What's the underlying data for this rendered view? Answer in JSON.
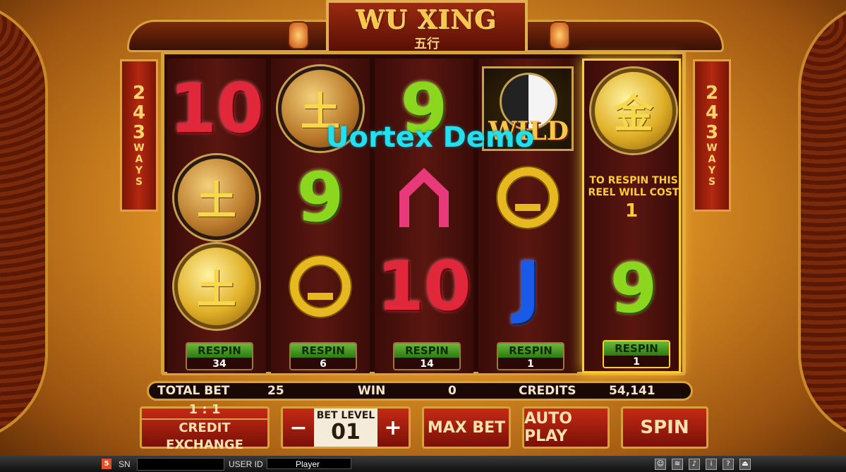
{
  "header": {
    "title": "WU XING",
    "subtitle": "五行"
  },
  "ways_banner": {
    "digits": [
      "2",
      "4",
      "3"
    ],
    "word_letters": [
      "W",
      "A",
      "Y",
      "S"
    ]
  },
  "watermark": "Uortex Demo",
  "reels": [
    {
      "symbols": [
        "10",
        "土",
        "土"
      ],
      "respin_label": "RESPIN",
      "respin_count": "34"
    },
    {
      "symbols": [
        "土",
        "9",
        "Q"
      ],
      "respin_label": "RESPIN",
      "respin_count": "6"
    },
    {
      "symbols": [
        "9",
        "A",
        "10"
      ],
      "respin_label": "RESPIN",
      "respin_count": "14"
    },
    {
      "symbols": [
        "WILD",
        "Q",
        "J"
      ],
      "respin_label": "RESPIN",
      "respin_count": "1"
    },
    {
      "symbols": [
        "金",
        "",
        "9"
      ],
      "respin_label": "RESPIN",
      "respin_count": "1",
      "respin_note": "TO RESPIN THIS REEL WILL COST",
      "respin_cost": "1",
      "active": true
    }
  ],
  "info_bar": {
    "total_bet_label": "TOTAL BET",
    "total_bet_value": "25",
    "win_label": "WIN",
    "win_value": "0",
    "credits_label": "CREDITS",
    "credits_value": "54,141"
  },
  "controls": {
    "exchange_ratio": "1 : 1",
    "credit_exchange_label": "CREDIT EXCHANGE",
    "bet_minus": "−",
    "bet_plus": "+",
    "bet_level_label": "BET LEVEL",
    "bet_level_value": "01",
    "max_bet_label": "MAX BET",
    "auto_play_label": "AUTO PLAY",
    "spin_label": "SPIN"
  },
  "bottom_bar": {
    "html5_badge": "5",
    "sn_label": "SN",
    "sn_value": "",
    "user_id_label": "USER ID",
    "user_id_value": "Player",
    "icons": [
      "account-icon",
      "signal-icon",
      "sound-icon",
      "info-icon",
      "help-icon",
      "exit-icon"
    ]
  },
  "colors": {
    "accent_gold": "#d8a23a",
    "reel_bg": "#2a0806",
    "respin_green": "#6ab83a",
    "watermark_cyan": "#22e0f0"
  }
}
